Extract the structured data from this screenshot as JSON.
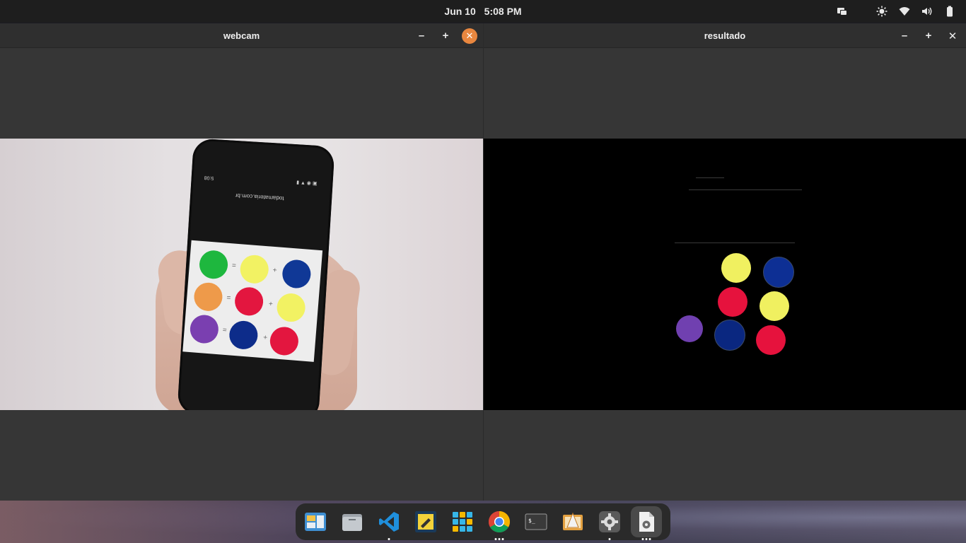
{
  "topbar": {
    "date": "Jun 10",
    "time": "5:08 PM",
    "tray_icons": [
      "screen-share-icon",
      "brightness-icon",
      "wifi-icon",
      "volume-icon",
      "battery-icon"
    ]
  },
  "windows": [
    {
      "title": "webcam",
      "controls": [
        "minimize",
        "maximize",
        "close"
      ],
      "focused": true,
      "accent": "#e9873f"
    },
    {
      "title": "resultado",
      "controls": [
        "minimize",
        "maximize",
        "close"
      ],
      "focused": false
    }
  ],
  "phone": {
    "url": "todamateria.com.br",
    "status_time": "5:08",
    "dots": [
      {
        "color": "#1eb73e",
        "name": "green"
      },
      {
        "color": "#f2f263",
        "name": "yellow"
      },
      {
        "color": "#103896",
        "name": "blue"
      },
      {
        "color": "#ee9a4a",
        "name": "orange"
      },
      {
        "color": "#e3163f",
        "name": "red"
      },
      {
        "color": "#f2f263",
        "name": "yellow"
      },
      {
        "color": "#7a3fb0",
        "name": "purple"
      },
      {
        "color": "#0d2c8a",
        "name": "blue"
      },
      {
        "color": "#e3163f",
        "name": "red"
      }
    ]
  },
  "result": {
    "dots": [
      {
        "color": "#f0f060",
        "name": "yellow"
      },
      {
        "color": "#0d2f94",
        "name": "blue"
      },
      {
        "color": "#e6123d",
        "name": "red"
      },
      {
        "color": "#f0f060",
        "name": "yellow"
      },
      {
        "color": "#7040b0",
        "name": "purple"
      },
      {
        "color": "#0a2780",
        "name": "blue"
      },
      {
        "color": "#e6123d",
        "name": "red"
      }
    ]
  },
  "dock": {
    "items": [
      {
        "name": "workspaces",
        "running": false
      },
      {
        "name": "files",
        "running": false
      },
      {
        "name": "vscode",
        "running": true
      },
      {
        "name": "system-tool",
        "running": false
      },
      {
        "name": "app-grid",
        "running": false
      },
      {
        "name": "chrome",
        "running": true
      },
      {
        "name": "terminal",
        "running": false
      },
      {
        "name": "installer",
        "running": false
      },
      {
        "name": "settings",
        "running": true
      },
      {
        "name": "python-app",
        "running": true
      }
    ]
  }
}
